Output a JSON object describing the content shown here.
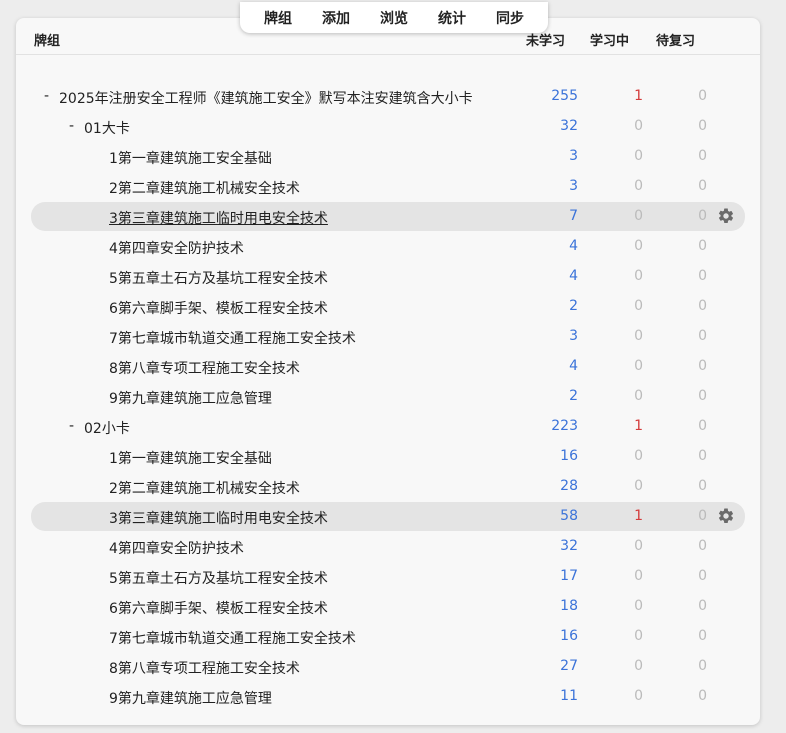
{
  "toolbar": {
    "items": [
      "牌组",
      "添加",
      "浏览",
      "统计",
      "同步"
    ]
  },
  "header": {
    "deck": "牌组",
    "new": "未学习",
    "learn": "学习中",
    "due": "待复习"
  },
  "decks": [
    {
      "level": 0,
      "collapse": "-",
      "name": "2025年注册安全工程师《建筑施工安全》默写本注安建筑含大小卡",
      "new": "255",
      "learn": "1",
      "due": "0"
    },
    {
      "level": 1,
      "collapse": "-",
      "name": "01大卡",
      "new": "32",
      "learn": "0",
      "due": "0"
    },
    {
      "level": 2,
      "collapse": "",
      "name": "1第一章建筑施工安全基础",
      "new": "3",
      "learn": "0",
      "due": "0"
    },
    {
      "level": 2,
      "collapse": "",
      "name": "2第二章建筑施工机械安全技术",
      "new": "3",
      "learn": "0",
      "due": "0"
    },
    {
      "level": 2,
      "collapse": "",
      "name": "3第三章建筑施工临时用电安全技术",
      "new": "7",
      "learn": "0",
      "due": "0",
      "highlight": true
    },
    {
      "level": 2,
      "collapse": "",
      "name": "4第四章安全防护技术",
      "new": "4",
      "learn": "0",
      "due": "0"
    },
    {
      "level": 2,
      "collapse": "",
      "name": "5第五章土石方及基坑工程安全技术",
      "new": "4",
      "learn": "0",
      "due": "0"
    },
    {
      "level": 2,
      "collapse": "",
      "name": "6第六章脚手架、模板工程安全技术",
      "new": "2",
      "learn": "0",
      "due": "0"
    },
    {
      "level": 2,
      "collapse": "",
      "name": "7第七章城市轨道交通工程施工安全技术",
      "new": "3",
      "learn": "0",
      "due": "0"
    },
    {
      "level": 2,
      "collapse": "",
      "name": "8第八章专项工程施工安全技术",
      "new": "4",
      "learn": "0",
      "due": "0"
    },
    {
      "level": 2,
      "collapse": "",
      "name": "9第九章建筑施工应急管理",
      "new": "2",
      "learn": "0",
      "due": "0"
    },
    {
      "level": 1,
      "collapse": "-",
      "name": "02小卡",
      "new": "223",
      "learn": "1",
      "due": "0"
    },
    {
      "level": 2,
      "collapse": "",
      "name": "1第一章建筑施工安全基础",
      "new": "16",
      "learn": "0",
      "due": "0"
    },
    {
      "level": 2,
      "collapse": "",
      "name": "2第二章建筑施工机械安全技术",
      "new": "28",
      "learn": "0",
      "due": "0"
    },
    {
      "level": 2,
      "collapse": "",
      "name": "3第三章建筑施工临时用电安全技术",
      "new": "58",
      "learn": "1",
      "due": "0",
      "highlight": true
    },
    {
      "level": 2,
      "collapse": "",
      "name": "4第四章安全防护技术",
      "new": "32",
      "learn": "0",
      "due": "0"
    },
    {
      "level": 2,
      "collapse": "",
      "name": "5第五章土石方及基坑工程安全技术",
      "new": "17",
      "learn": "0",
      "due": "0"
    },
    {
      "level": 2,
      "collapse": "",
      "name": "6第六章脚手架、模板工程安全技术",
      "new": "18",
      "learn": "0",
      "due": "0"
    },
    {
      "level": 2,
      "collapse": "",
      "name": "7第七章城市轨道交通工程施工安全技术",
      "new": "16",
      "learn": "0",
      "due": "0"
    },
    {
      "level": 2,
      "collapse": "",
      "name": "8第八章专项工程施工安全技术",
      "new": "27",
      "learn": "0",
      "due": "0"
    },
    {
      "level": 2,
      "collapse": "",
      "name": "9第九章建筑施工应急管理",
      "new": "11",
      "learn": "0",
      "due": "0"
    }
  ],
  "colors": {
    "new": "#3b73d9",
    "learn": "#d43c3c",
    "zero": "#bbbbbb"
  }
}
